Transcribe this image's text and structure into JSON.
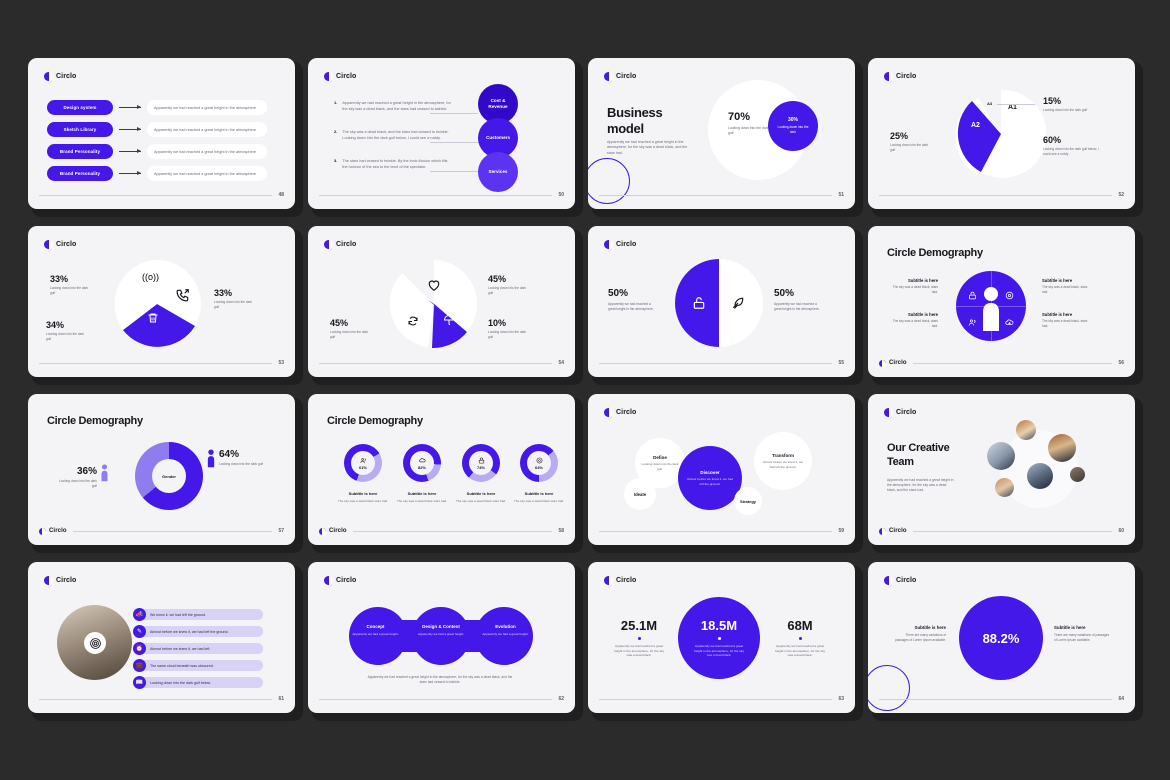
{
  "brand": {
    "name": "Circlo",
    "accent": "#4318e8",
    "accent_light": "#8f7cf0",
    "dark": "#16161d",
    "slide_bg": "#f4f4f6",
    "page_bg": "#2b2b2b"
  },
  "slides": [
    {
      "id": "s48",
      "page": "48",
      "logo": "Circlo",
      "items": [
        {
          "pill": "Design system",
          "text": "Apparently  we had reached a great height in the atmosphere"
        },
        {
          "pill": "Sketch Library",
          "text": "Apparently  we had reached a great height in the atmosphere"
        },
        {
          "pill": "Brand Personality",
          "text": "Apparently  we had reached a great height in the atmosphere"
        },
        {
          "pill": "Brand Personality",
          "text": "Apparently  we had reached a great height in the atmosphere"
        }
      ]
    },
    {
      "id": "s50",
      "page": "50",
      "logo": "Circlo",
      "list": [
        {
          "idx": "1.",
          "text": "Apparently  we had reached a great height in the atmosphere, for the sky was a dead black, and the stars had ceased to twinkle."
        },
        {
          "idx": "2.",
          "text": "The sky was a dead black, and the stars had ceased to twinkle. Looking down into the dark gulf below, I could see a ruddy."
        },
        {
          "idx": "3.",
          "text": "The stars had ceased to twinkle. By the ionic illusion which fills the horizon of the sea to the level of the spectator."
        }
      ],
      "circles": [
        {
          "label": "Cost &\nRevenue"
        },
        {
          "label": "Customers"
        },
        {
          "label": "Services"
        }
      ]
    },
    {
      "id": "s51",
      "page": "51",
      "logo": "Circlo",
      "title": "Business\nmodel",
      "body": "Apparently  we had reached a great height in the atmosphere, for the sky was a dead black, and the stars had.",
      "chart_data": {
        "type": "pie",
        "title": "Business model",
        "labels": [
          "70%",
          "30%"
        ],
        "values": [
          70,
          30
        ],
        "captions": [
          "Looking down into the dark gulf",
          "Looking down into the dark"
        ],
        "colors": [
          "#ffffff",
          "#4318e8"
        ]
      }
    },
    {
      "id": "s52",
      "page": "52",
      "logo": "Circlo",
      "chart_data": {
        "type": "pie",
        "title": "",
        "labels": [
          "A1",
          "A2",
          "A3"
        ],
        "values": [
          60,
          25,
          15
        ],
        "legend": [
          {
            "value": "25%",
            "caption": "Looking down into the dark gulf"
          },
          {
            "value": "15%",
            "caption": "Looking down into the dark gulf"
          },
          {
            "value": "60%",
            "caption": "Looking down into the dark gulf below, I could see a ruddy."
          }
        ],
        "colors": [
          "#ffffff",
          "#4318e8",
          "#ffffff"
        ]
      }
    },
    {
      "id": "s53",
      "page": "53",
      "logo": "Circlo",
      "chart_data": {
        "type": "pie",
        "labels": [
          "33%",
          "33%",
          "34%"
        ],
        "values": [
          33,
          33,
          34
        ],
        "icons": [
          "broadcast-icon",
          "phone-arrow-icon",
          "trash-icon"
        ],
        "captions": [
          "Looking down into the dark gulf",
          "Looking down into the dark gulf",
          "Looking down into the dark gulf"
        ],
        "colors": [
          "#ffffff",
          "#ffffff",
          "#4318e8"
        ]
      }
    },
    {
      "id": "s54",
      "page": "54",
      "logo": "Circlo",
      "chart_data": {
        "type": "pie",
        "labels": [
          "45%",
          "45%",
          "10%"
        ],
        "values": [
          45,
          45,
          10
        ],
        "icons": [
          "heart-icon",
          "refresh-icon",
          "umbrella-icon"
        ],
        "captions": [
          "Looking down into the dark gulf",
          "Looking down into the dark gulf",
          "Looking down into the dark gulf"
        ],
        "colors": [
          "#ffffff",
          "#ffffff",
          "#4318e8"
        ]
      }
    },
    {
      "id": "s55",
      "page": "55",
      "logo": "Circlo",
      "chart_data": {
        "type": "pie",
        "labels": [
          "50%",
          "50%"
        ],
        "values": [
          50,
          50
        ],
        "icons": [
          "unlock-icon",
          "feather-icon"
        ],
        "captions": [
          "Apparently  we had reached a great height in the atmosphere.",
          "Apparently  we had reached a great height in the atmosphere."
        ],
        "colors": [
          "#4318e8",
          "#ffffff"
        ]
      }
    },
    {
      "id": "s56",
      "page": "56",
      "logo": "Circlo",
      "title": "Circle Demography",
      "quadrants": [
        {
          "heading": "Subtitle is here",
          "text": "The sky was a dead black, stars had.",
          "icon": "lock-icon"
        },
        {
          "heading": "Subtitle is here",
          "text": "The sky was a dead black, stars had.",
          "icon": "target-icon"
        },
        {
          "heading": "Subtitle is here",
          "text": "The sky was a dead black, stars had.",
          "icon": "users-icon"
        },
        {
          "heading": "Subtitle is here",
          "text": "The sky was a dead black, stars had.",
          "icon": "cloud-upload-icon"
        }
      ]
    },
    {
      "id": "s57",
      "page": "57",
      "logo": "Circlo",
      "title": "Circle Demography",
      "chart_data": {
        "type": "pie",
        "title": "Gender",
        "center_label": "Gender",
        "labels": [
          "36%",
          "64%"
        ],
        "values": [
          36,
          64
        ],
        "captions": [
          "Looking down into the dark gulf",
          "Looking down into the dark gulf"
        ],
        "colors": [
          "#8f7cf0",
          "#4318e8"
        ]
      }
    },
    {
      "id": "s58",
      "page": "58",
      "logo": "Circlo",
      "title": "Circle Demography",
      "chart_data": {
        "type": "pie",
        "donuts": [
          {
            "value": 61,
            "label": "61%",
            "icon": "user-group-icon",
            "heading": "Subtitle is here",
            "text": "The sky was a dead black stars had."
          },
          {
            "value": 82,
            "label": "82%",
            "icon": "cloud-icon",
            "heading": "Subtitle is here",
            "text": "The sky was a dead black stars had."
          },
          {
            "value": 74,
            "label": "74%",
            "icon": "lock-icon",
            "heading": "Subtitle is here",
            "text": "The sky was a dead black stars had."
          },
          {
            "value": 64,
            "label": "64%",
            "icon": "target-icon",
            "heading": "Subtitle is here",
            "text": "The sky was a dead black stars had."
          }
        ],
        "colors": [
          "#4318e8",
          "#b9aaf5"
        ]
      }
    },
    {
      "id": "s59",
      "page": "59",
      "logo": "Circlo",
      "bubbles": [
        {
          "label": "Define",
          "text": "Looking down into the dark gulf."
        },
        {
          "label": "Discover",
          "text": "Almost before we knew it, we had left the ground."
        },
        {
          "label": "Transform",
          "text": "Almost before we knew it, we had left the ground."
        },
        {
          "label": "Ideate",
          "text": ""
        },
        {
          "label": "Strategy",
          "text": ""
        }
      ]
    },
    {
      "id": "s60",
      "page": "60",
      "logo": "Circlo",
      "title": "Our Creative\nTeam",
      "body": "Apparently  we had reached a great height in the atmosphere, for the sky was a dead black, and the stars had."
    },
    {
      "id": "s61",
      "page": "61",
      "logo": "Circlo",
      "rows": [
        {
          "icon": "megaphone-icon",
          "text": "We knew it, we had left the ground."
        },
        {
          "icon": "pen-icon",
          "text": "Almost before we knew it, we had left the ground."
        },
        {
          "icon": "clock-icon",
          "text": "Almost before we knew it, we had left."
        },
        {
          "icon": "briefcase-icon",
          "text": "The same cloud beneath was obscured."
        },
        {
          "icon": "book-icon",
          "text": "Looking down into the dark gulf below."
        }
      ]
    },
    {
      "id": "s62",
      "page": "62",
      "logo": "Circlo",
      "steps": [
        {
          "label": "Concept",
          "text": "Apparently  we had a great height."
        },
        {
          "label": "Design & Content",
          "text": "Apparently  we had a great height."
        },
        {
          "label": "Evolution",
          "text": "Apparently  we had a great height."
        }
      ],
      "caption": "Apparently  we had reached a great height in the atmosphere, for the sky was a dead black, and the stars had ceased to twinkle."
    },
    {
      "id": "s63",
      "page": "63",
      "logo": "Circlo",
      "chart_data": {
        "type": "bar",
        "categories": [
          "25.1M",
          "18.5M",
          "68M"
        ],
        "values": [
          25.1,
          18.5,
          68
        ],
        "title": "",
        "captions": [
          "Apparently  we had reached a great height in the atmosphere, for the sky was a dead black.",
          "Apparently  we had reached a great height in the atmosphere, for the sky was a dead black.",
          "Apparently  we had reached a great height in the atmosphere, for the sky was a dead black."
        ]
      }
    },
    {
      "id": "s64",
      "page": "64",
      "logo": "Circlo",
      "chart_data": {
        "type": "pie",
        "labels": [
          "88.2%"
        ],
        "values": [
          88.2
        ],
        "left": {
          "heading": "Subtitle is here",
          "text": "There are many variations of passages of Lorem Ipsum available."
        },
        "right": {
          "heading": "Subtitle is here",
          "text": "There are many variations of passages of Lorem Ipsum available."
        }
      }
    }
  ]
}
